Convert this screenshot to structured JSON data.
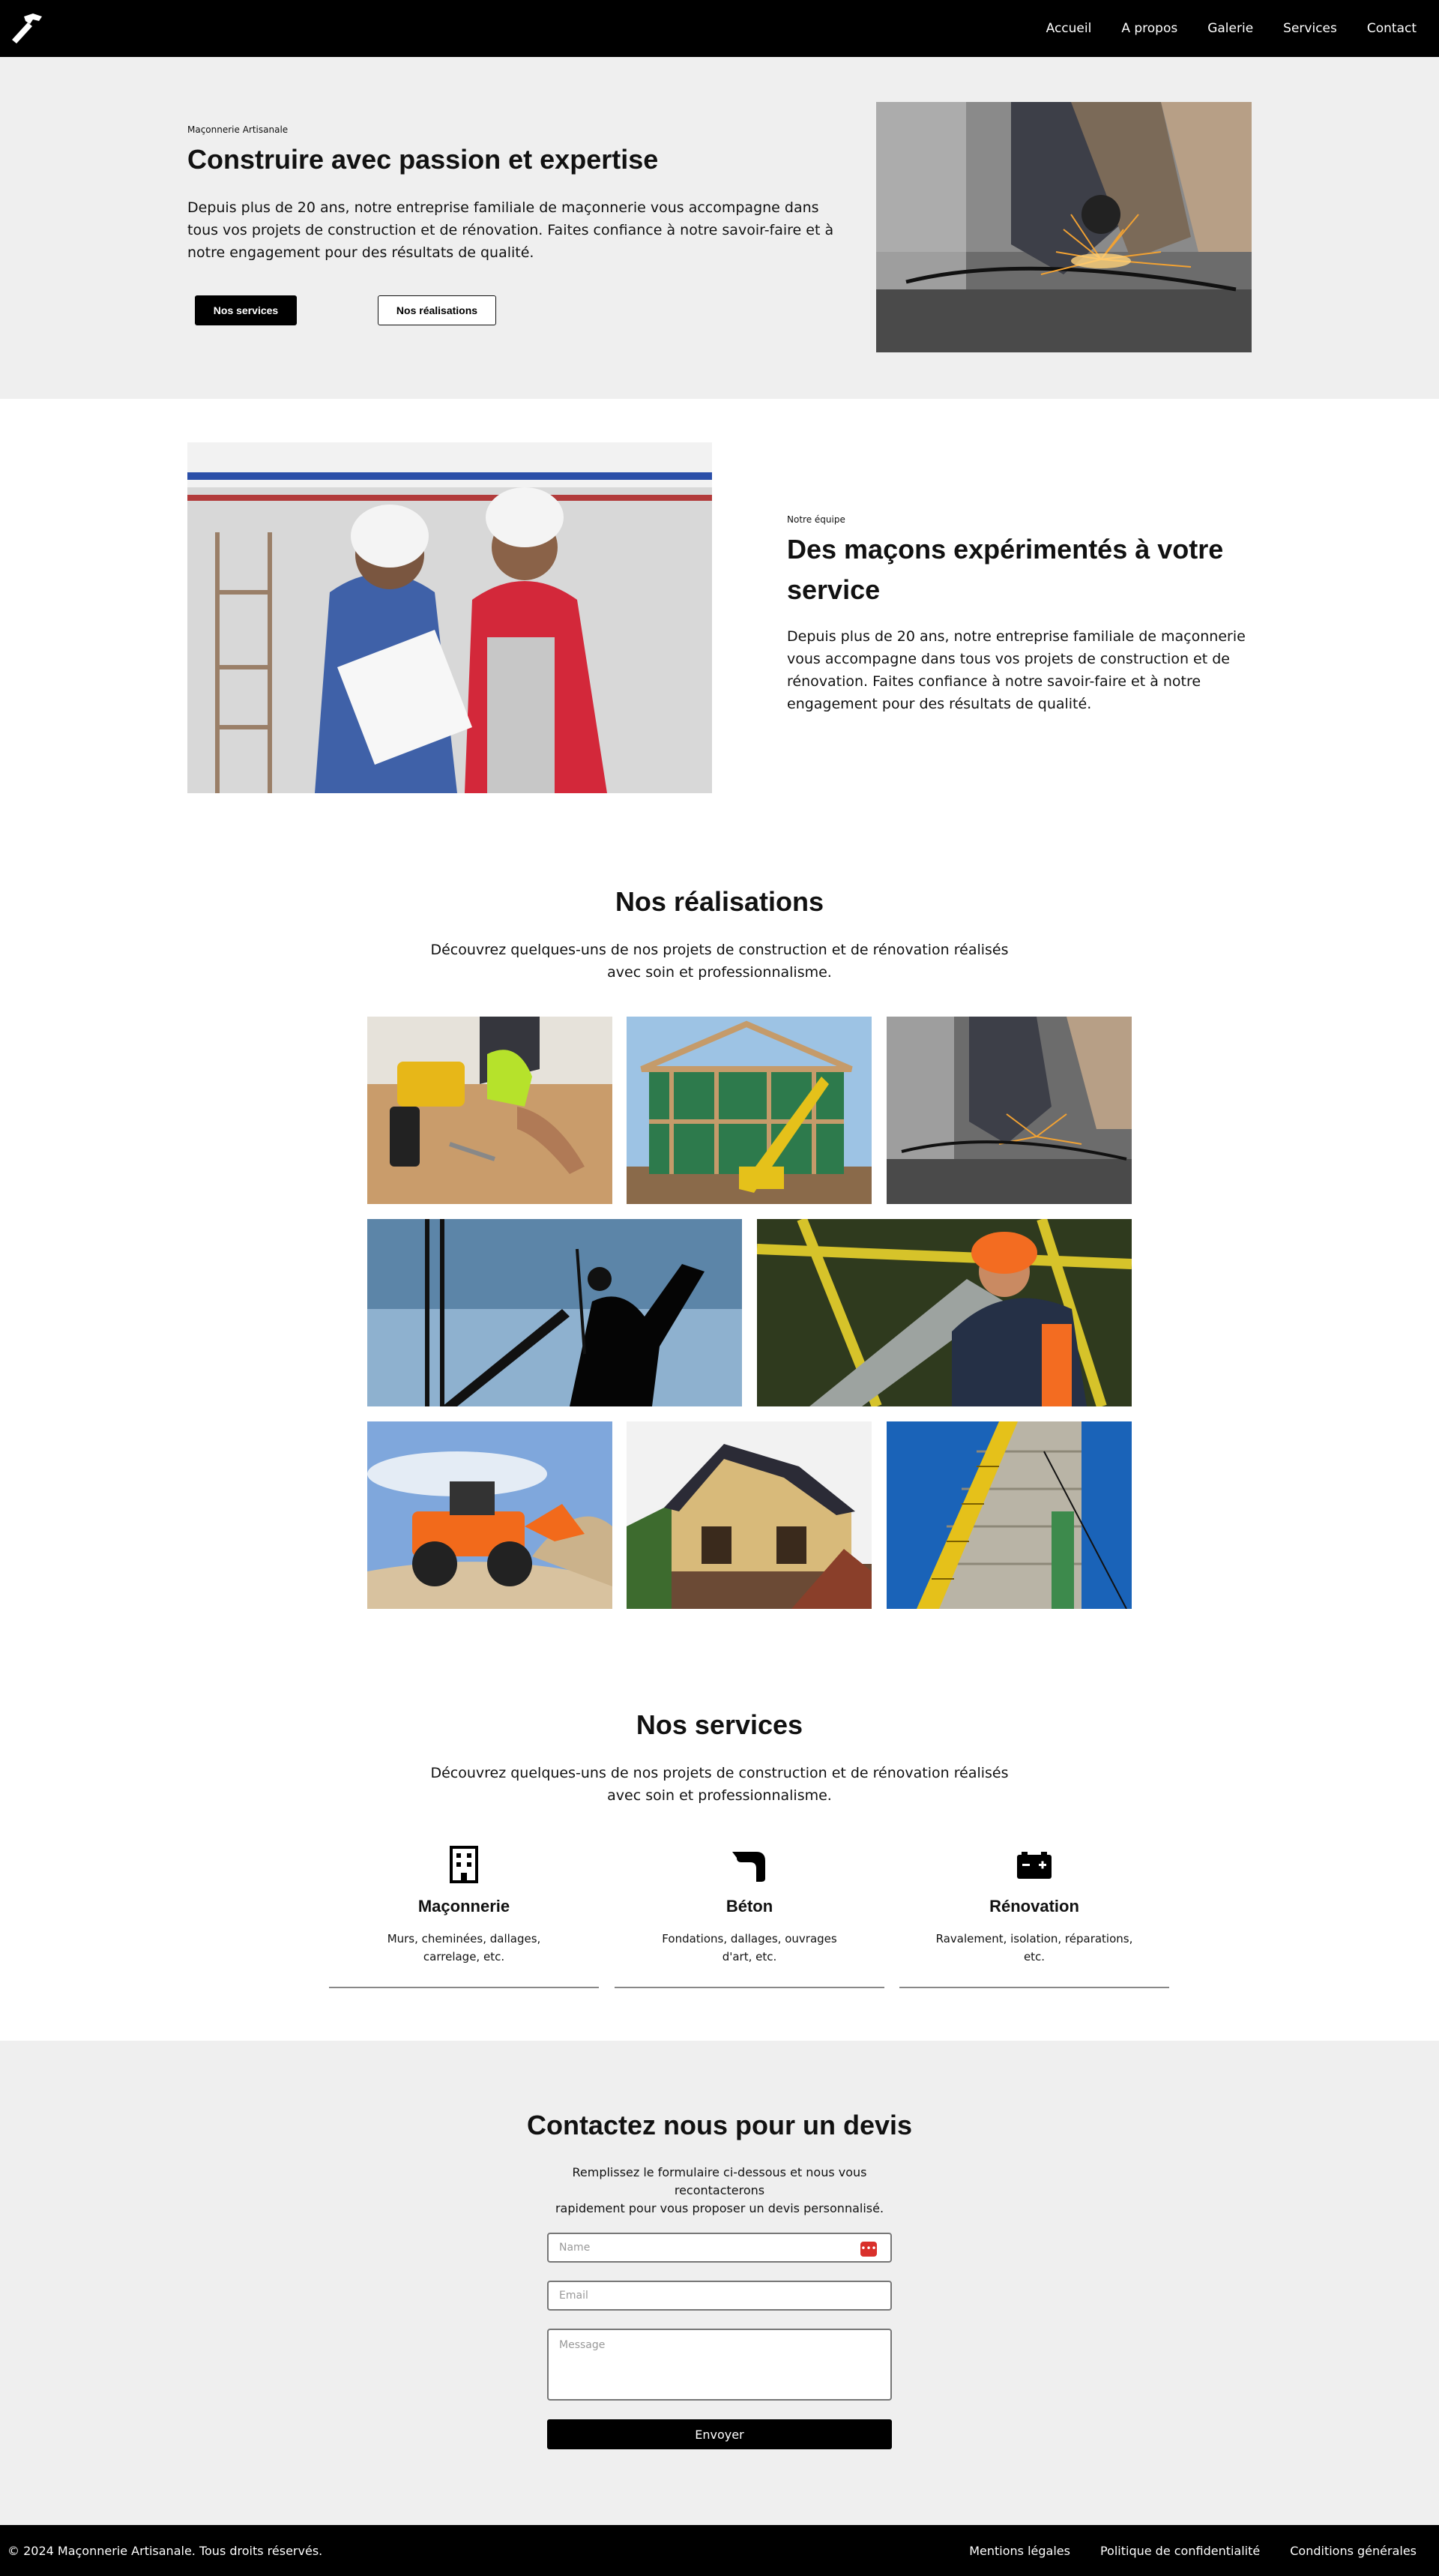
{
  "header": {
    "logo_icon": "hammer-icon",
    "nav": [
      "Accueil",
      "A propos",
      "Galerie",
      "Services",
      "Contact"
    ]
  },
  "hero": {
    "eyebrow": "Maçonnerie Artisanale",
    "title": "Construire avec passion et expertise",
    "text": "Depuis plus de 20 ans, notre entreprise familiale de maçonnerie vous accompagne dans tous vos projets de construction et de rénovation. Faites confiance à notre savoir-faire et à notre engagement pour des résultats de qualité.",
    "primary_button": "Nos services",
    "secondary_button": "Nos réalisations",
    "image": "worker-grinding-sparks-photo"
  },
  "team": {
    "eyebrow": "Notre équipe",
    "title": "Des maçons expérimentés à votre service",
    "text": "Depuis plus de 20 ans, notre entreprise familiale de maçonnerie vous accompagne dans tous vos projets de construction et de rénovation. Faites confiance à notre savoir-faire et à notre engagement pour des résultats de qualité.",
    "image": "two-builders-reading-plans-photo"
  },
  "gallery": {
    "title": "Nos réalisations",
    "subtitle": "Découvrez quelques-uns de nos projets de construction et de rénovation réalisés avec soin et professionnalisme.",
    "images": [
      "drill-on-wood-photo",
      "house-frame-construction-photo",
      "worker-grinding-sparks-photo",
      "crane-silhouette-worker-photo",
      "worker-carrying-pipe-photo",
      "orange-wheel-loader-photo",
      "wooden-house-under-construction-photo",
      "high-rise-tower-crane-photo"
    ]
  },
  "services": {
    "title": "Nos services",
    "subtitle": "Découvrez quelques-uns de nos projets de construction et de rénovation réalisés avec soin et professionnalisme.",
    "items": [
      {
        "icon": "building-icon",
        "title": "Maçonnerie",
        "text": "Murs, cheminées, dallages, carrelage, etc."
      },
      {
        "icon": "trowel-icon",
        "title": "Béton",
        "text": "Fondations, dallages, ouvrages d'art, etc."
      },
      {
        "icon": "battery-icon",
        "title": "Rénovation",
        "text": "Ravalement, isolation, réparations, etc."
      }
    ]
  },
  "contact": {
    "title": "Contactez nous pour un devis",
    "text_line1": "Remplissez le formulaire ci-dessous et nous vous recontacterons",
    "text_line2": "rapidement pour vous proposer un devis personnalisé.",
    "name_placeholder": "Name",
    "email_placeholder": "Email",
    "message_placeholder": "Message",
    "submit": "Envoyer",
    "field_icon": "autofill-dots-icon"
  },
  "footer": {
    "copyright": "© 2024 Maçonnerie Artisanale. Tous droits réservés.",
    "links": [
      "Mentions légales",
      "Politique de confidentialité",
      "Conditions générales"
    ]
  },
  "colors": {
    "header_bg": "#000000",
    "section_alt_bg": "#efefef",
    "accent_red": "#d9302b"
  }
}
